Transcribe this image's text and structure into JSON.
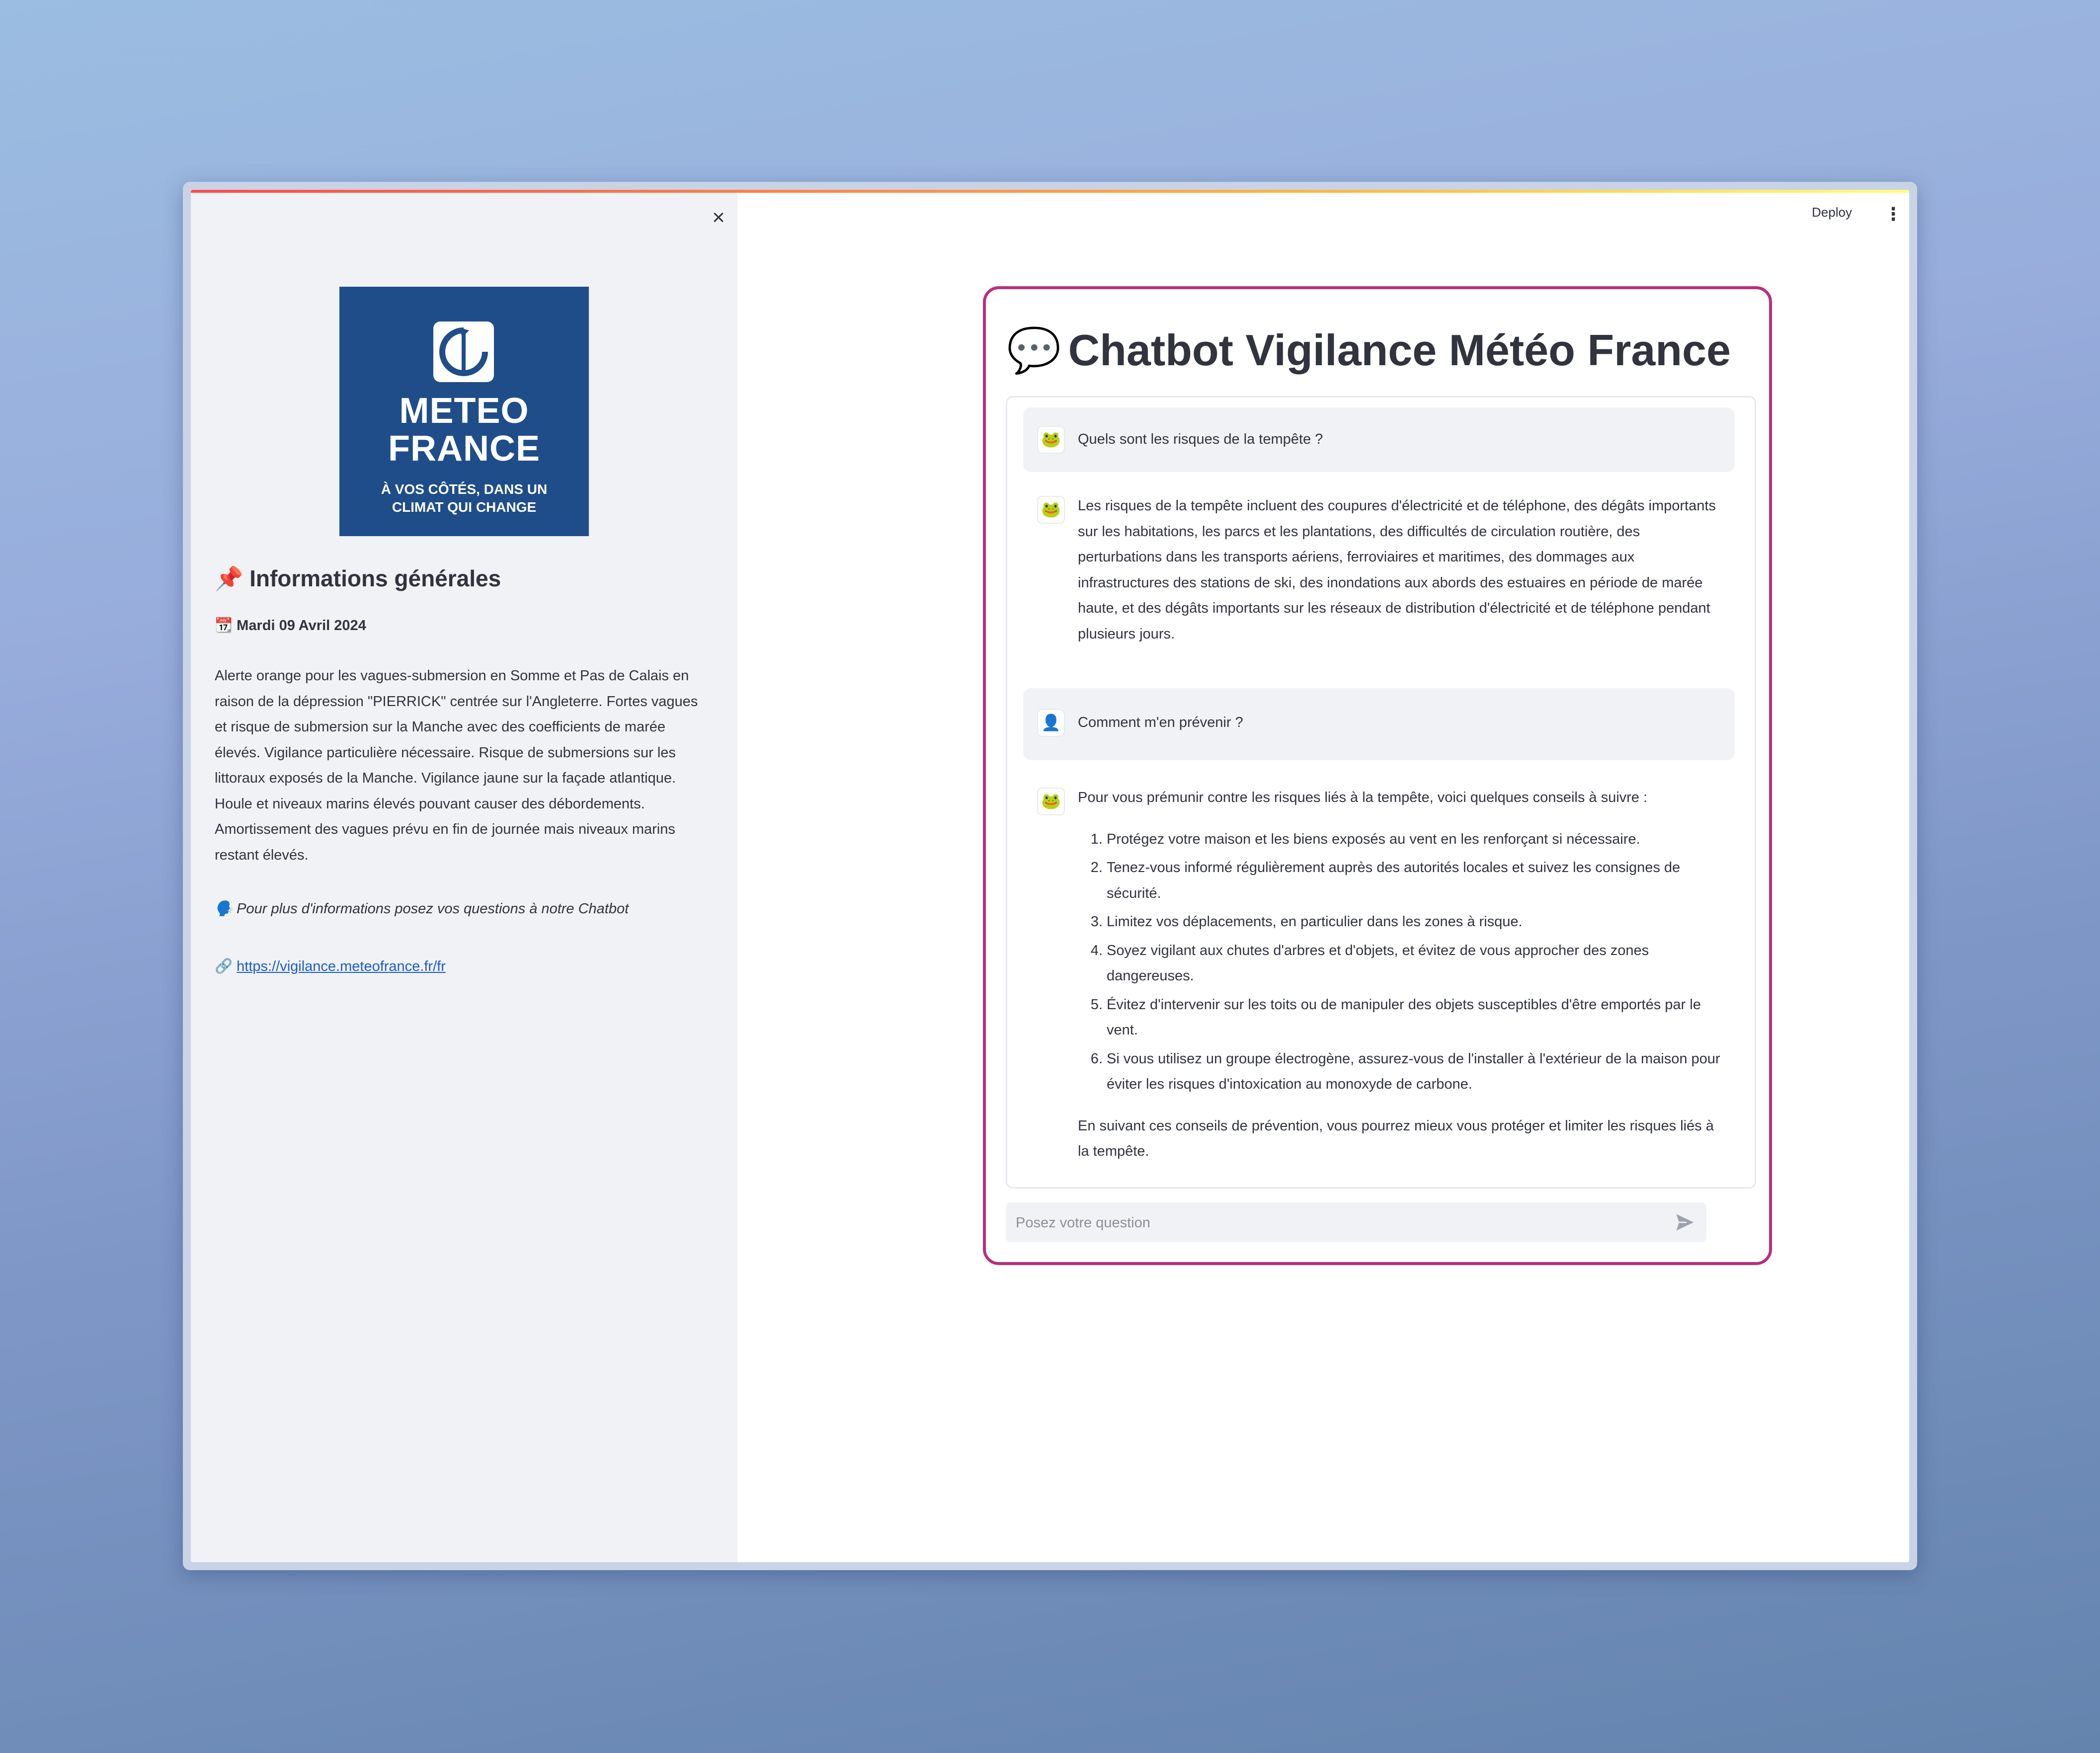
{
  "sidebar": {
    "close_glyph": "×",
    "logo": {
      "line1": "METEO",
      "line2": "FRANCE",
      "tagline": "À VOS CÔTÉS, DANS UN CLIMAT QUI CHANGE"
    },
    "heading_emoji": "📌",
    "heading": "Informations générales",
    "date_emoji": "📆",
    "date": "Mardi 09 Avril 2024",
    "alert": "Alerte orange pour les vagues-submersion en Somme et Pas de Calais en raison de la dépression \"PIERRICK\" centrée sur l'Angleterre. Fortes vagues et risque de submersion sur la Manche avec des coefficients de marée élevés. Vigilance particulière nécessaire. Risque de submersions sur les littoraux exposés de la Manche. Vigilance jaune sur la façade atlantique. Houle et niveaux marins élevés pouvant causer des débordements. Amortissement des vagues prévu en fin de journée mais niveaux marins restant élevés.",
    "prompt_emoji": "🗣️",
    "prompt": "Pour plus d'informations posez vos questions à notre Chatbot",
    "link_emoji": "🔗",
    "link": "https://vigilance.meteofrance.fr/fr"
  },
  "header": {
    "deploy": "Deploy",
    "menu_glyph": "⋮"
  },
  "chat": {
    "title_emoji": "💬",
    "title": "Chatbot Vigilance Météo France",
    "messages": {
      "m1": {
        "avatar": "🐸",
        "text": "Quels sont les risques de la tempête ?"
      },
      "m2": {
        "avatar": "🐸",
        "text": "Les risques de la tempête incluent des coupures d'électricité et de téléphone, des dégâts importants sur les habitations, les parcs et les plantations, des difficultés de circulation routière, des perturbations dans les transports aériens, ferroviaires et maritimes, des dommages aux infrastructures des stations de ski, des inondations aux abords des estuaires en période de marée haute, et des dégâts importants sur les réseaux de distribution d'électricité et de téléphone pendant plusieurs jours."
      },
      "m3": {
        "avatar": "👤",
        "text": "Comment m'en prévenir ?"
      },
      "m4": {
        "avatar": "🐸",
        "intro": "Pour vous prémunir contre les risques liés à la tempête, voici quelques conseils à suivre :",
        "items": [
          "Protégez votre maison et les biens exposés au vent en les renforçant si nécessaire.",
          "Tenez-vous informé régulièrement auprès des autorités locales et suivez les consignes de sécurité.",
          "Limitez vos déplacements, en particulier dans les zones à risque.",
          "Soyez vigilant aux chutes d'arbres et d'objets, et évitez de vous approcher des zones dangereuses.",
          "Évitez d'intervenir sur les toits ou de manipuler des objets susceptibles d'être emportés par le vent.",
          "Si vous utilisez un groupe électrogène, assurez-vous de l'installer à l'extérieur de la maison pour éviter les risques d'intoxication au monoxyde de carbone."
        ],
        "conclusion": "En suivant ces conseils de prévention, vous pourrez mieux vous protéger et limiter les risques liés à la tempête."
      }
    },
    "input_placeholder": "Posez votre question"
  },
  "colors": {
    "card_border": "#b8307b",
    "logo_bg": "#1f4d89",
    "sidebar_bg": "#f0f2f6",
    "link": "#1c5cc8"
  }
}
